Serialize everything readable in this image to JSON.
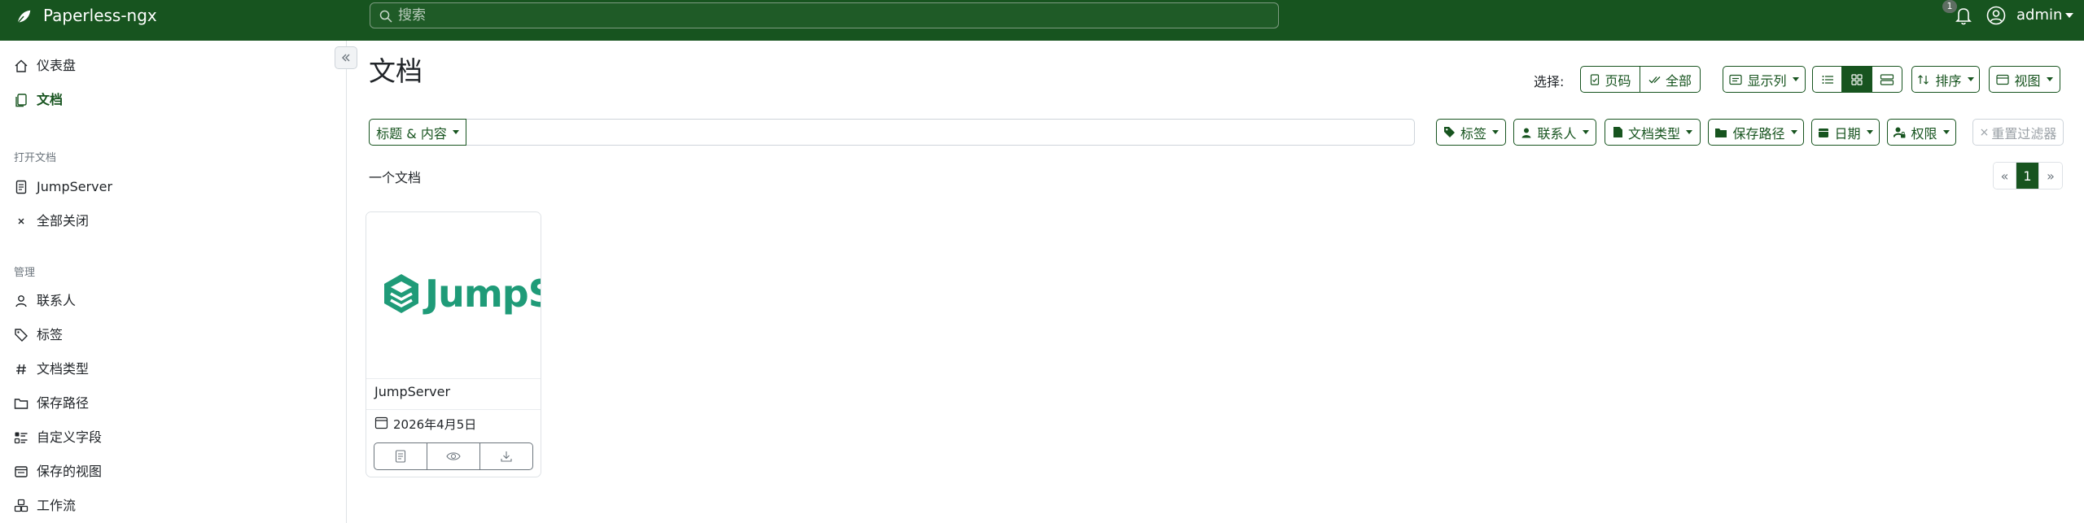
{
  "app": {
    "name": "Paperless-ngx"
  },
  "search": {
    "placeholder": "搜索"
  },
  "notifications": {
    "count": "1"
  },
  "user": {
    "name": "admin"
  },
  "sidebar": {
    "items": [
      {
        "label": "仪表盘"
      },
      {
        "label": "文档"
      }
    ],
    "open_docs_heading": "打开文档",
    "open_docs": [
      {
        "label": "JumpServer"
      },
      {
        "label": "全部关闭"
      }
    ],
    "manage_heading": "管理",
    "manage": [
      {
        "label": "联系人"
      },
      {
        "label": "标签"
      },
      {
        "label": "文档类型"
      },
      {
        "label": "保存路径"
      },
      {
        "label": "自定义字段"
      },
      {
        "label": "保存的视图"
      },
      {
        "label": "工作流"
      }
    ]
  },
  "page": {
    "title": "文档",
    "select_label": "选择:",
    "select_page": "页码",
    "select_all": "全部",
    "show_columns": "显示列",
    "sort": "排序",
    "views": "视图"
  },
  "filters": {
    "title_content": "标题 & 内容",
    "tags": "标签",
    "correspondent": "联系人",
    "doc_type": "文档类型",
    "storage_path": "保存路径",
    "date": "日期",
    "permissions": "权限",
    "reset": "重置过滤器"
  },
  "results": {
    "count_text": "一个文档",
    "pagination": {
      "prev": "«",
      "current": "1",
      "next": "»"
    }
  },
  "documents": [
    {
      "title": "JumpServer",
      "thumb_text": "JumpServer",
      "date": "2026年4月5日"
    }
  ],
  "colors": {
    "primary": "#17541f",
    "thumb_green": "#1f9b78"
  }
}
